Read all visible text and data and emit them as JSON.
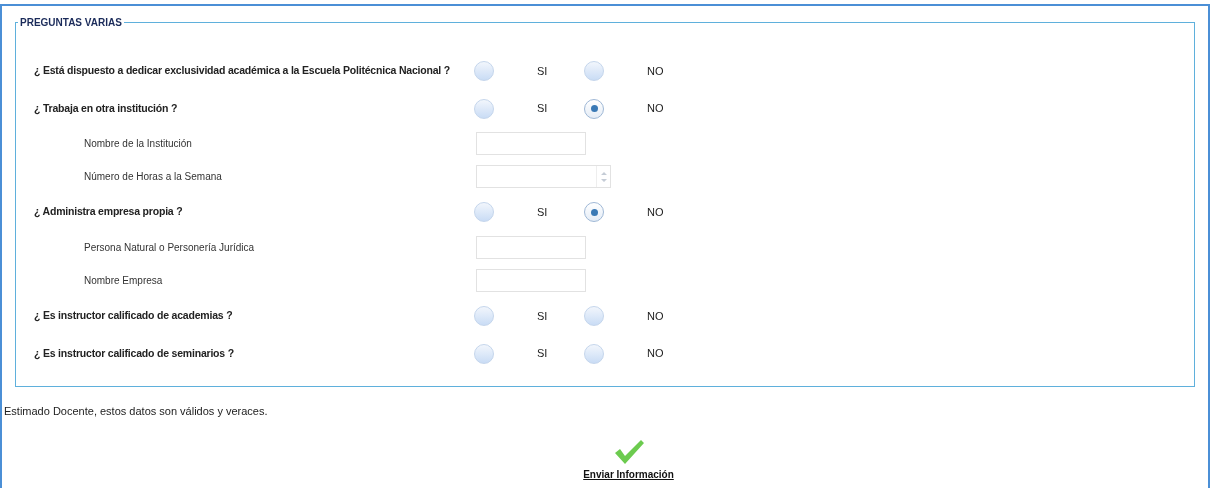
{
  "section": {
    "legend": "PREGUNTAS VARIAS"
  },
  "rows": [
    {
      "kind": "question",
      "label": "¿ Está dispuesto a dedicar exclusividad académica a la Escuela Politécnica Nacional ?",
      "options": [
        {
          "label": "SI",
          "selected": false
        },
        {
          "label": "NO",
          "selected": false
        }
      ]
    },
    {
      "kind": "question",
      "label": "¿ Trabaja en otra institución ?",
      "options": [
        {
          "label": "SI",
          "selected": false
        },
        {
          "label": "NO",
          "selected": true
        }
      ]
    },
    {
      "kind": "text",
      "label": "Nombre de la Institución"
    },
    {
      "kind": "number",
      "label": "Número de Horas a la Semana"
    },
    {
      "kind": "question",
      "label": "¿ Administra empresa propia ?",
      "options": [
        {
          "label": "SI",
          "selected": false
        },
        {
          "label": "NO",
          "selected": true
        }
      ]
    },
    {
      "kind": "text",
      "label": "Persona Natural o Personería Jurídica"
    },
    {
      "kind": "text",
      "label": "Nombre Empresa"
    },
    {
      "kind": "question",
      "label": "¿ Es instructor calificado de academias ?",
      "options": [
        {
          "label": "SI",
          "selected": false
        },
        {
          "label": "NO",
          "selected": false
        }
      ]
    },
    {
      "kind": "question",
      "label": "¿ Es instructor calificado de seminarios ?",
      "options": [
        {
          "label": "SI",
          "selected": false
        },
        {
          "label": "NO",
          "selected": false
        }
      ]
    }
  ],
  "note": "Estimado Docente, estos datos son válidos y veraces.",
  "submit": {
    "label": "Enviar Información"
  }
}
